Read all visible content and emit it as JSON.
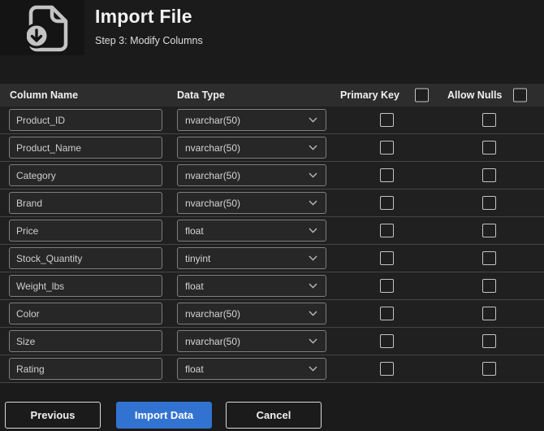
{
  "header": {
    "title": "Import File",
    "subtitle": "Step 3: Modify Columns",
    "icon": "import-file-icon"
  },
  "table": {
    "columns": {
      "column_name": "Column Name",
      "data_type": "Data Type",
      "primary_key": "Primary Key",
      "allow_nulls": "Allow Nulls"
    },
    "select_all": {
      "primary_key_checked": false,
      "allow_nulls_checked": false
    },
    "rows": [
      {
        "column_name": "Product_ID",
        "data_type": "nvarchar(50)",
        "primary_key": false,
        "allow_nulls": false
      },
      {
        "column_name": "Product_Name",
        "data_type": "nvarchar(50)",
        "primary_key": false,
        "allow_nulls": false
      },
      {
        "column_name": "Category",
        "data_type": "nvarchar(50)",
        "primary_key": false,
        "allow_nulls": false
      },
      {
        "column_name": "Brand",
        "data_type": "nvarchar(50)",
        "primary_key": false,
        "allow_nulls": false
      },
      {
        "column_name": "Price",
        "data_type": "float",
        "primary_key": false,
        "allow_nulls": false
      },
      {
        "column_name": "Stock_Quantity",
        "data_type": "tinyint",
        "primary_key": false,
        "allow_nulls": false
      },
      {
        "column_name": "Weight_lbs",
        "data_type": "float",
        "primary_key": false,
        "allow_nulls": false
      },
      {
        "column_name": "Color",
        "data_type": "nvarchar(50)",
        "primary_key": false,
        "allow_nulls": false
      },
      {
        "column_name": "Size",
        "data_type": "nvarchar(50)",
        "primary_key": false,
        "allow_nulls": false
      },
      {
        "column_name": "Rating",
        "data_type": "float",
        "primary_key": false,
        "allow_nulls": false
      }
    ]
  },
  "footer": {
    "buttons": {
      "previous": "Previous",
      "import": "Import Data",
      "cancel": "Cancel"
    }
  },
  "colors": {
    "accent_blue": "#3273d1",
    "page_bg": "#1b1b1b",
    "table_header_bg": "#2d2d2d",
    "row_bg": "#202020",
    "control_border": "#7f7f7f"
  }
}
